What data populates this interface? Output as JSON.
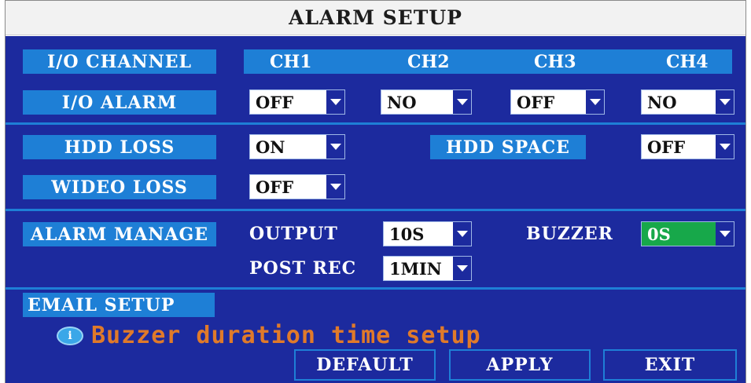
{
  "title": "ALARM SETUP",
  "io_channel": {
    "label": "I/O CHANNEL",
    "channels": [
      "CH1",
      "CH2",
      "CH3",
      "CH4"
    ]
  },
  "io_alarm": {
    "label": "I/O ALARM",
    "values": [
      "OFF",
      "NO",
      "OFF",
      "NO"
    ]
  },
  "hdd_loss": {
    "label": "HDD LOSS",
    "value": "ON"
  },
  "hdd_space": {
    "label": "HDD SPACE",
    "value": "OFF"
  },
  "video_loss": {
    "label": "WIDEO LOSS",
    "value": "OFF"
  },
  "alarm_manage": {
    "label": "ALARM MANAGE",
    "output_label": "OUTPUT",
    "output_value": "10S",
    "buzzer_label": "BUZZER",
    "buzzer_value": "0S",
    "post_rec_label": "POST REC",
    "post_rec_value": "1MIN"
  },
  "email_setup": {
    "label": "EMAIL SETUP"
  },
  "hint": {
    "icon": "info-bubble-icon",
    "text": "Buzzer duration time setup"
  },
  "buttons": {
    "default": "DEFAULT",
    "apply": "APPLY",
    "exit": "EXIT"
  },
  "colors": {
    "panel": "#1c2a9e",
    "label_bg": "#1e7fd6",
    "hint_text": "#e07a2a",
    "selected_field": "#17a84a"
  }
}
